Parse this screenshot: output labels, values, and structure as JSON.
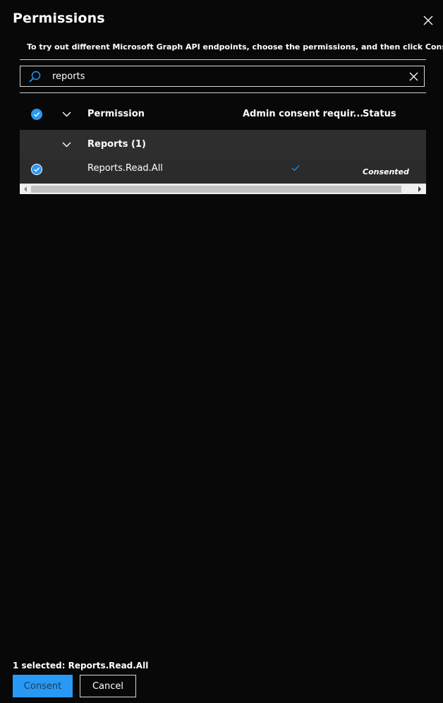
{
  "panel": {
    "title": "Permissions",
    "subtitle": "To try out different Microsoft Graph API endpoints, choose the permissions, and then click Consent."
  },
  "search": {
    "value": "reports"
  },
  "table": {
    "columns": {
      "permission": "Permission",
      "admin_consent": "Admin consent requir...",
      "status": "Status"
    },
    "groups": [
      {
        "label": "Reports (1)",
        "items": [
          {
            "name": "Reports.Read.All",
            "admin_consent_required": true,
            "status": "Consented",
            "selected": true
          }
        ]
      }
    ]
  },
  "footer": {
    "selection_summary": "1 selected: Reports.Read.All",
    "consent_label": "Consent",
    "cancel_label": "Cancel"
  },
  "colors": {
    "accent": "#2899f5",
    "background": "#080808",
    "group_row": "#2e2e2e"
  },
  "icons": {
    "close": "close-icon",
    "search": "search-icon",
    "clear": "clear-icon",
    "select_all": "checkmark-circle-icon",
    "collapse": "chevron-down-icon",
    "admin_check": "checkmark-icon"
  }
}
